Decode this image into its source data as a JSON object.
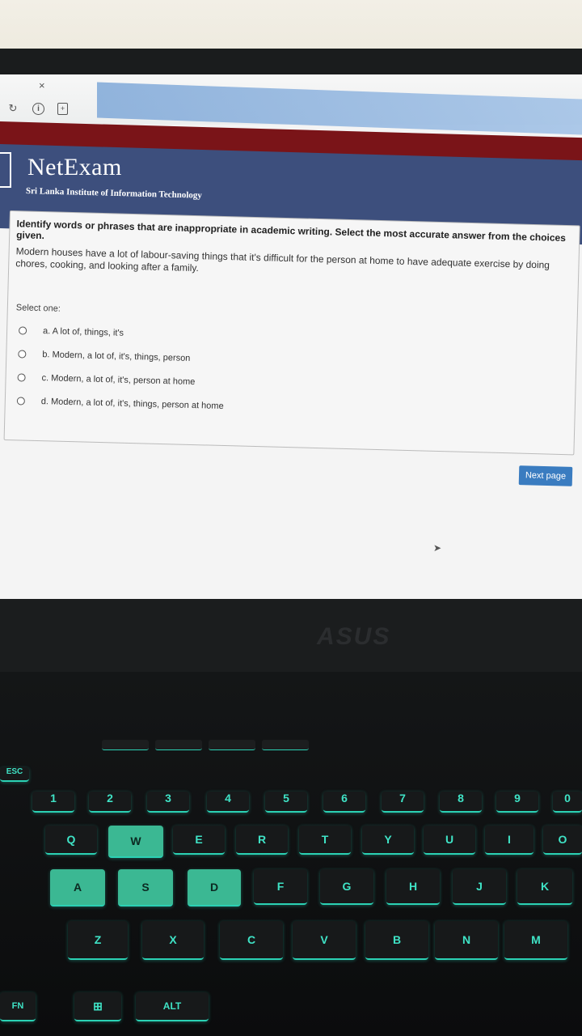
{
  "browser": {
    "tab_close": "×",
    "icons": [
      "reload-icon",
      "info-icon",
      "page-icon"
    ]
  },
  "site": {
    "brand": "NetExam",
    "institute": "Sri Lanka Institute of Information Technology"
  },
  "question": {
    "title": "Identify words or phrases that are inappropriate in academic writing. Select the most accurate answer from the choices given.",
    "text": "Modern houses have a lot of labour-saving things that it's difficult for the person at home to have adequate exercise by doing chores, cooking, and looking after a family.",
    "select_label": "Select one:",
    "options": [
      "a. A lot of, things, it's",
      "b. Modern, a lot of, it's, things, person",
      "c. Modern, a lot of, it's, person at home",
      "d. Modern, a lot of, it's, things, person at home"
    ]
  },
  "navigation": {
    "next_label": "Next page"
  },
  "laptop": {
    "logo": "ASUS"
  },
  "keyboard": {
    "row_numbers": [
      "1",
      "2",
      "3",
      "4",
      "5",
      "6",
      "7",
      "8",
      "9",
      "0"
    ],
    "row_top": [
      "Q",
      "W",
      "E",
      "R",
      "T",
      "Y",
      "U",
      "I",
      "O"
    ],
    "row_home": [
      "A",
      "S",
      "D",
      "F",
      "G",
      "H",
      "J",
      "K"
    ],
    "row_bottom": [
      "Z",
      "X",
      "C",
      "V",
      "B",
      "N",
      "M"
    ],
    "fn": "FN",
    "alt": "ALT",
    "esc": "ESC"
  },
  "colors": {
    "header_blue": "#3d4f7d",
    "header_red": "#7a1418",
    "button_blue": "#3a7cc0",
    "keyboard_glow": "#2bd1b4"
  }
}
